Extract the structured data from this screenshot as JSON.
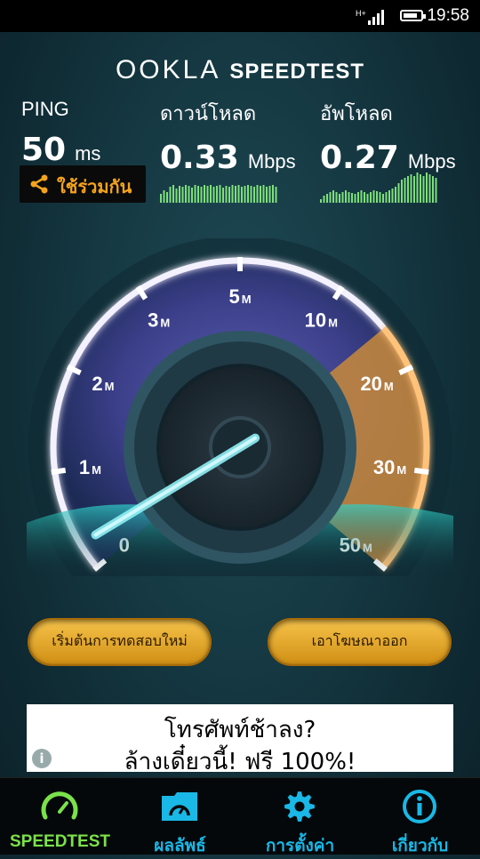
{
  "status_bar": {
    "network": "H+",
    "time": "19:58"
  },
  "header": {
    "brand_left": "OOKLA",
    "brand_right": "SPEEDTEST"
  },
  "metrics": {
    "ping": {
      "label": "PING",
      "value": "50",
      "unit": "ms"
    },
    "download": {
      "label": "ดาวน์โหลด",
      "value": "0.33",
      "unit": "Mbps"
    },
    "upload": {
      "label": "อัพโหลด",
      "value": "0.27",
      "unit": "Mbps"
    }
  },
  "share": {
    "label": "ใช้ร่วมกัน",
    "icon": "share-icon"
  },
  "gauge": {
    "ticks": [
      {
        "num": "0",
        "unit": ""
      },
      {
        "num": "1",
        "unit": "M"
      },
      {
        "num": "2",
        "unit": "M"
      },
      {
        "num": "3",
        "unit": "M"
      },
      {
        "num": "5",
        "unit": "M"
      },
      {
        "num": "10",
        "unit": "M"
      },
      {
        "num": "20",
        "unit": "M"
      },
      {
        "num": "30",
        "unit": "M"
      },
      {
        "num": "50",
        "unit": "M"
      }
    ],
    "needle_value_mbps": 0.27,
    "accent_color": "#c98a3a"
  },
  "buttons": {
    "restart": "เริ่มต้นการทดสอบใหม่",
    "remove_ads": "เอาโฆษณาออก"
  },
  "ad": {
    "line1": "โทรศัพท์ช้าลง?",
    "line2": "ล้างเดี๋ยวนี้! ฟรี 100%!",
    "info_glyph": "i"
  },
  "nav": {
    "items": [
      {
        "label": "SPEEDTEST",
        "icon": "speedometer-icon",
        "active": true
      },
      {
        "label": "ผลลัพธ์",
        "icon": "results-folder-icon",
        "active": false
      },
      {
        "label": "การตั้งค่า",
        "icon": "gear-icon",
        "active": false
      },
      {
        "label": "เกี่ยวกับ",
        "icon": "info-icon",
        "active": false
      }
    ]
  },
  "colors": {
    "accent_green": "#7be24a",
    "accent_blue": "#19b8e6",
    "button_gold": "#f0b636"
  }
}
